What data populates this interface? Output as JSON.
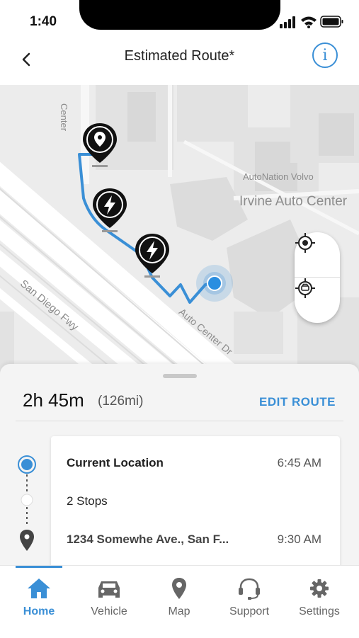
{
  "status_bar": {
    "time": "1:40",
    "icons": [
      "signal-icon",
      "wifi-icon",
      "battery-icon"
    ]
  },
  "header": {
    "title": "Estimated Route*",
    "back_icon": "chevron-left-icon",
    "info_icon": "info-icon",
    "info_glyph": "i"
  },
  "map": {
    "labels": {
      "road_vertical": "Center",
      "freeway": "San Diego Fwy",
      "auto_center_dr": "Auto Center Dr",
      "dealer": "AutoNation Volvo",
      "area": "Irvine Auto Center"
    },
    "markers": [
      {
        "type": "location-pin-icon"
      },
      {
        "type": "charging-bolt-icon"
      },
      {
        "type": "charging-bolt-icon"
      }
    ],
    "route_color": "#3a8fd6",
    "controls": [
      "recenter-icon",
      "follow-vehicle-icon"
    ]
  },
  "route_summary": {
    "duration": "2h 45m",
    "distance": "(126mi)",
    "edit_label": "EDIT ROUTE"
  },
  "stops": [
    {
      "name": "Current Location",
      "time": "6:45 AM"
    },
    {
      "name": "2 Stops",
      "time": ""
    },
    {
      "name": "1234 Somewhe Ave., San F...",
      "time": "9:30 AM"
    }
  ],
  "bottom_nav": [
    {
      "label": "Home",
      "icon": "home-icon",
      "active": true
    },
    {
      "label": "Vehicle",
      "icon": "car-icon",
      "active": false
    },
    {
      "label": "Map",
      "icon": "map-pin-icon",
      "active": false
    },
    {
      "label": "Support",
      "icon": "headset-icon",
      "active": false
    },
    {
      "label": "Settings",
      "icon": "gear-icon",
      "active": false
    }
  ],
  "colors": {
    "accent": "#3a8fd6",
    "map_bg": "#ececec",
    "sheet_bg": "#f4f4f4"
  }
}
